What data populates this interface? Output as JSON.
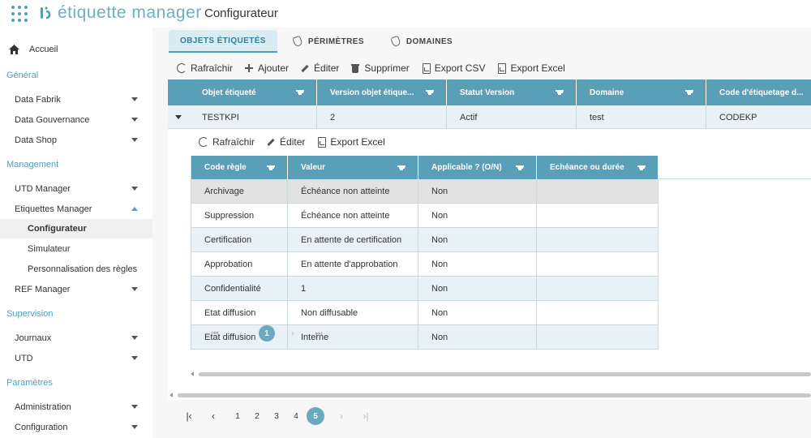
{
  "app": {
    "logo_text": "étiquette manager",
    "page_title": "Configurateur"
  },
  "sidebar": {
    "home": "Accueil",
    "sections": {
      "general": "Général",
      "management": "Management",
      "supervision": "Supervision",
      "parametres": "Paramètres"
    },
    "items": {
      "data_fabrik": "Data Fabrik",
      "data_gouvernance": "Data Gouvernance",
      "data_shop": "Data Shop",
      "utd_manager": "UTD Manager",
      "etiquettes_manager": "Etiquettes Manager",
      "configurateur": "Configurateur",
      "simulateur": "Simulateur",
      "personnalisation": "Personnalisation des règles",
      "ref_manager": "REF Manager",
      "journaux": "Journaux",
      "utd": "UTD",
      "administration": "Administration",
      "configuration": "Configuration"
    }
  },
  "tabs": [
    "OBJETS ÉTIQUETÉS",
    "PÉRIMÈTRES",
    "DOMAINES"
  ],
  "toolbar": {
    "refresh": "Rafraîchir",
    "add": "Ajouter",
    "edit": "Éditer",
    "delete": "Supprimer",
    "export_csv": "Export CSV",
    "export_excel": "Export Excel"
  },
  "outer_grid": {
    "columns": [
      "Objet étiqueté",
      "Version objet étique...",
      "Statut Version",
      "Domaine",
      "Code d'étiquetage d..."
    ],
    "row": [
      "TESTKPI",
      "2",
      "Actif",
      "test",
      "CODEKP"
    ]
  },
  "inner_toolbar": {
    "refresh": "Rafraîchir",
    "edit": "Éditer",
    "export_excel": "Export Excel"
  },
  "inner_grid": {
    "columns": [
      "Code règle",
      "Valeur",
      "Applicable ? (O/N)",
      "Echéance ou durée"
    ],
    "rows": [
      [
        "Archivage",
        "Échéance non atteinte",
        "Non",
        ""
      ],
      [
        "Suppression",
        "Échéance non atteinte",
        "Non",
        ""
      ],
      [
        "Certification",
        "En attente de certification",
        "Non",
        ""
      ],
      [
        "Approbation",
        "En attente d'approbation",
        "Non",
        ""
      ],
      [
        "Confidentialité",
        "1",
        "Non",
        ""
      ],
      [
        "Etat diffusion",
        "Non diffusable",
        "Non",
        ""
      ],
      [
        "Etat diffusion",
        "Interne",
        "Non",
        ""
      ]
    ],
    "pager": {
      "first": "⏮",
      "prev": "‹",
      "current": "1",
      "next": "›",
      "last": "⏭"
    }
  },
  "main_pager": {
    "first": "|‹",
    "prev": "‹",
    "pages": [
      "1",
      "2",
      "3",
      "4",
      "5"
    ],
    "current": "5",
    "next": "›",
    "last": "›|"
  },
  "colors": {
    "accent": "#4fa0b7",
    "header": "#5a9fb8",
    "row_alt": "#e8f2f6"
  }
}
